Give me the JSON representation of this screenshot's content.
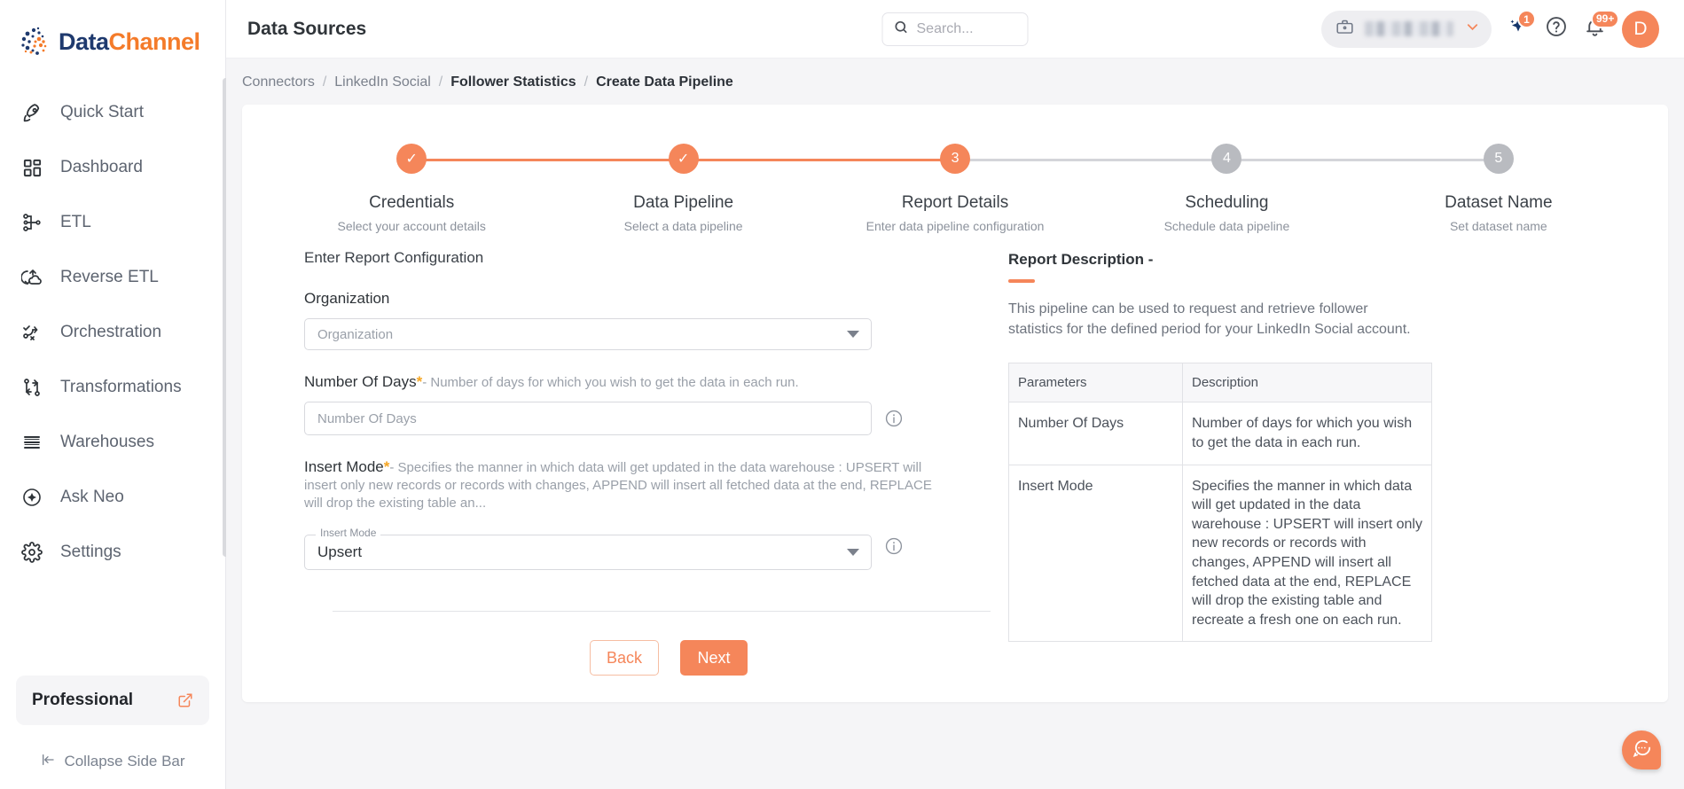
{
  "brand": {
    "logo_text_1": "Data",
    "logo_text_2": "Channel",
    "accent": "#f5865a",
    "navy": "#1f3a6e",
    "orange": "#f47b2a"
  },
  "sidebar": {
    "items": [
      {
        "label": "Quick Start",
        "icon": "rocket-icon"
      },
      {
        "label": "Dashboard",
        "icon": "grid-icon"
      },
      {
        "label": "ETL",
        "icon": "etl-icon"
      },
      {
        "label": "Reverse ETL",
        "icon": "reverse-etl-icon"
      },
      {
        "label": "Orchestration",
        "icon": "orchestration-icon"
      },
      {
        "label": "Transformations",
        "icon": "transformations-icon"
      },
      {
        "label": "Warehouses",
        "icon": "warehouses-icon"
      },
      {
        "label": "Ask Neo",
        "icon": "sparkle-circle-icon"
      },
      {
        "label": "Settings",
        "icon": "gear-icon"
      }
    ],
    "plan": {
      "label": "Professional",
      "icon": "external-link-icon"
    },
    "collapse": {
      "label": "Collapse Side Bar",
      "icon": "collapse-left-icon"
    }
  },
  "topbar": {
    "title": "Data Sources",
    "search": {
      "placeholder": "Search...",
      "value": "",
      "icon": "search-icon"
    },
    "workspace": {
      "name": "",
      "icon": "briefcase-icon",
      "chevron": "chevron-down-icon"
    },
    "ai_icon": {
      "name": "sparkle-icon",
      "badge": "1"
    },
    "help_icon": {
      "name": "help-circle-icon"
    },
    "notifications_icon": {
      "name": "bell-icon",
      "badge": "99+"
    },
    "avatar": {
      "initial": "D"
    }
  },
  "breadcrumb": {
    "items": [
      {
        "label": "Connectors",
        "active": false
      },
      {
        "label": "LinkedIn Social",
        "active": false
      },
      {
        "label": "Follower Statistics",
        "active": true
      },
      {
        "label": "Create Data Pipeline",
        "active": true
      }
    ],
    "separator": "/"
  },
  "stepper": {
    "steps": [
      {
        "number": "1",
        "title": "Credentials",
        "subtitle": "Select your account details",
        "state": "done",
        "mark": "✓"
      },
      {
        "number": "2",
        "title": "Data Pipeline",
        "subtitle": "Select a data pipeline",
        "state": "done",
        "mark": "✓"
      },
      {
        "number": "3",
        "title": "Report Details",
        "subtitle": "Enter data pipeline configuration",
        "state": "current",
        "mark": "3"
      },
      {
        "number": "4",
        "title": "Scheduling",
        "subtitle": "Schedule data pipeline",
        "state": "todo",
        "mark": "4"
      },
      {
        "number": "5",
        "title": "Dataset Name",
        "subtitle": "Set dataset name",
        "state": "todo",
        "mark": "5"
      }
    ]
  },
  "form": {
    "section_title": "Enter Report Configuration",
    "organization": {
      "label": "Organization",
      "placeholder": "Organization",
      "value": ""
    },
    "number_of_days": {
      "label": "Number Of Days",
      "required_mark": "*",
      "hint": "- Number of days for which you wish to get the data in each run.",
      "placeholder": "Number Of Days",
      "value": "",
      "info_icon": "info-icon"
    },
    "insert_mode": {
      "label": "Insert Mode",
      "required_mark": "*",
      "hint": "- Specifies the manner in which data will get updated in the data warehouse : UPSERT will insert only new records or records with changes, APPEND will insert all fetched data at the end, REPLACE will drop the existing table an...",
      "float_label": "Insert Mode",
      "value": "Upsert",
      "info_icon": "info-icon"
    },
    "buttons": {
      "back": "Back",
      "next": "Next"
    }
  },
  "report_description": {
    "title": "Report Description -",
    "text": "This pipeline can be used to request and retrieve follower statistics for the defined period for your LinkedIn Social account.",
    "table": {
      "headers": [
        "Parameters",
        "Description"
      ],
      "rows": [
        {
          "parameter": "Number Of Days",
          "description": "Number of days for which you wish to get the data in each run."
        },
        {
          "parameter": "Insert Mode",
          "description": "Specifies the manner in which data will get updated in the data warehouse : UPSERT will insert only new records or records with changes, APPEND will insert all fetched data at the end, REPLACE will drop the existing table and recreate a fresh one on each run."
        }
      ]
    }
  },
  "chat": {
    "icon": "chat-bubble-icon"
  }
}
